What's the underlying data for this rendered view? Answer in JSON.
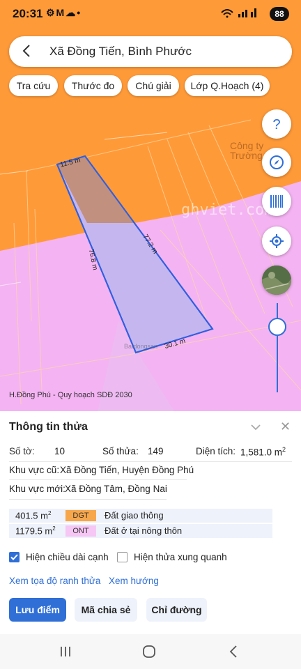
{
  "status_bar": {
    "time": "20:31",
    "battery": "88"
  },
  "search": {
    "query": "Xã Đồng Tiến, Bình Phước"
  },
  "chips": [
    "Tra cứu",
    "Thước đo",
    "Chú giải",
    "Lớp Q.Hoạch (4)"
  ],
  "map": {
    "caption": "H.Đồng Phú - Quy hoạch SDĐ 2030",
    "watermark": "ghviet.com",
    "company_label_1": "Công ty",
    "company_label_2": "Trường",
    "center_logo": "Batdongsan",
    "edges": {
      "top": "11.5 m",
      "left": "76.8 m",
      "right": "77.2 m",
      "bottom": "30.1 m"
    },
    "colors": {
      "orange_zone": "#ff9a38",
      "pink_zone": "#f4b3f2",
      "parcel_fill": "#c5b6f0",
      "parcel_border": "#2f5fe0"
    }
  },
  "panel": {
    "title": "Thông tin thửa",
    "so_to_label": "Số tờ:",
    "so_to_value": "10",
    "so_thua_label": "Số thửa:",
    "so_thua_value": "149",
    "dien_tich_label": "Diện tích:",
    "dien_tich_value": "1,581.0 m",
    "dien_tich_sup": "2",
    "khu_vuc_cu_label": "Khu vực cũ:",
    "khu_vuc_cu_value": "Xã Đồng Tiến, Huyện Đồng Phú",
    "khu_vuc_moi_label": "Khu vực mới:",
    "khu_vuc_moi_value": "Xã Đồng Tâm, Đồng Nai",
    "land_use": [
      {
        "area": "401.5 m",
        "sup": "2",
        "code": "DGT",
        "name": "Đất giao thông",
        "color": "#f7a64a"
      },
      {
        "area": "1179.5 m",
        "sup": "2",
        "code": "ONT",
        "name": "Đất ở tại nông thôn",
        "color": "#f6c7f4"
      }
    ],
    "checkbox_edges": "Hiện chiều dài cạnh",
    "checkbox_edges_checked": true,
    "checkbox_neighbors": "Hiện thửa xung quanh",
    "checkbox_neighbors_checked": false,
    "link_coords": "Xem tọa độ ranh thửa",
    "link_direction": "Xem hướng",
    "btn_save": "Lưu điểm",
    "btn_share": "Mã chia sẻ",
    "btn_directions": "Chỉ đường"
  }
}
